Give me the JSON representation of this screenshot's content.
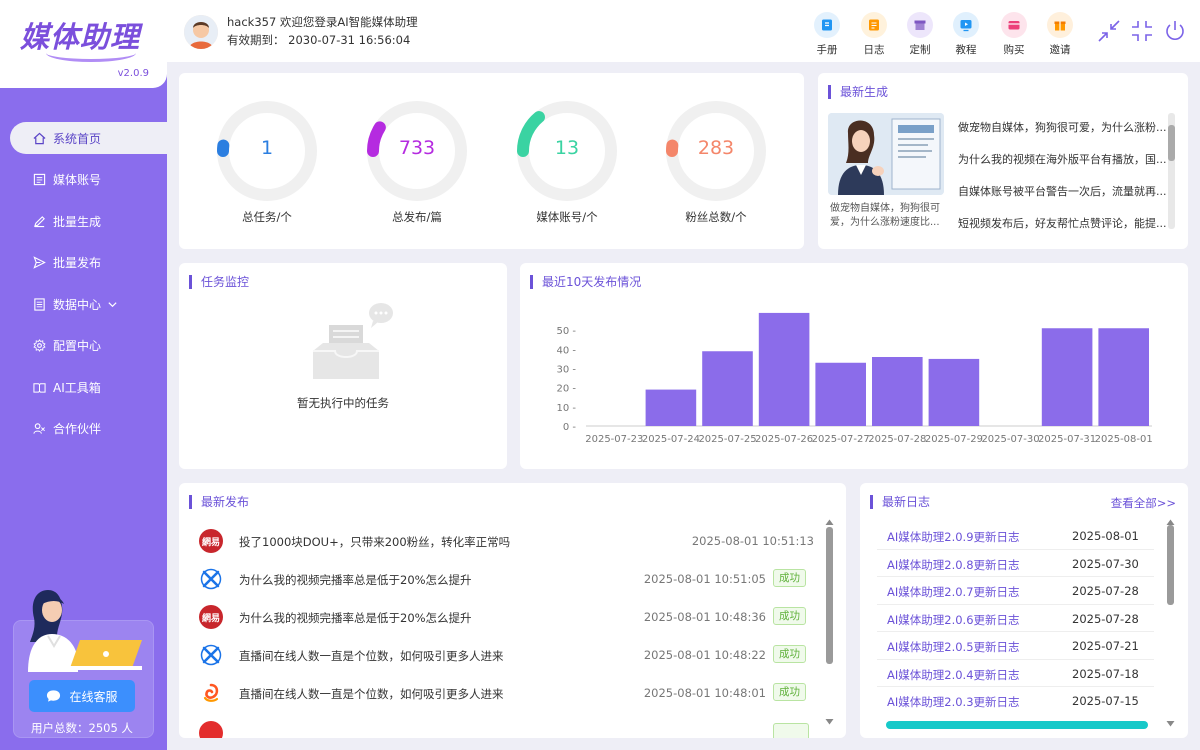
{
  "sidebar": {
    "logo": "媒体助理",
    "version": "v2.0.9",
    "items": [
      {
        "label": "系统首页",
        "icon": "home-icon",
        "active": true
      },
      {
        "label": "媒体账号",
        "icon": "account-card-icon"
      },
      {
        "label": "批量生成",
        "icon": "pencil-icon"
      },
      {
        "label": "批量发布",
        "icon": "send-icon"
      },
      {
        "label": "数据中心",
        "icon": "document-icon",
        "expandable": true
      },
      {
        "label": "配置中心",
        "icon": "gear-icon"
      },
      {
        "label": "AI工具箱",
        "icon": "toolbox-icon"
      },
      {
        "label": "合作伙伴",
        "icon": "partner-icon"
      }
    ],
    "support_label": "在线客服",
    "user_total": "用户总数：2505 人"
  },
  "header": {
    "welcome": "hack357 欢迎您登录AI智能媒体助理",
    "expire": "有效期到： 2030-07-31 16:56:04",
    "tools": [
      {
        "label": "手册",
        "icon": "manual-icon",
        "color": "#2196f3"
      },
      {
        "label": "日志",
        "icon": "log-icon",
        "color": "#ff9800"
      },
      {
        "label": "定制",
        "icon": "custom-icon",
        "color": "#7e57c2"
      },
      {
        "label": "教程",
        "icon": "tutorial-icon",
        "color": "#2196f3"
      },
      {
        "label": "购买",
        "icon": "purchase-icon",
        "color": "#ec407a"
      },
      {
        "label": "邀请",
        "icon": "invite-icon",
        "color": "#ff9800"
      }
    ]
  },
  "stats": [
    {
      "value": "1",
      "label": "总任务/个",
      "color": "#2b7ee0",
      "fraction": 0.02
    },
    {
      "value": "733",
      "label": "总发布/篇",
      "color": "#b52be0",
      "fraction": 0.09
    },
    {
      "value": "13",
      "label": "媒体账号/个",
      "color": "#3ad3a2",
      "fraction": 0.14
    },
    {
      "value": "283",
      "label": "粉丝总数/个",
      "color": "#f4866a",
      "fraction": 0.02
    }
  ],
  "latest": {
    "title": "最新生成",
    "caption": "做宠物自媒体，狗狗很可爱，为什么涨粉速度比...",
    "items": [
      "做宠物自媒体，狗狗很可爱，为什么涨粉...",
      "为什么我的视频在海外版平台有播放，国...",
      "自媒体账号被平台警告一次后，流量就再...",
      "短视频发布后，好友帮忙点赞评论，能提..."
    ]
  },
  "monitor": {
    "title": "任务监控",
    "empty": "暂无执行中的任务"
  },
  "chart_panel": {
    "title": "最近10天发布情况"
  },
  "chart_data": {
    "type": "bar",
    "categories": [
      "2025-07-23",
      "2025-07-24",
      "2025-07-25",
      "2025-07-26",
      "2025-07-27",
      "2025-07-28",
      "2025-07-29",
      "2025-07-30",
      "2025-07-31",
      "2025-08-01"
    ],
    "values": [
      0,
      19,
      39,
      59,
      33,
      36,
      35,
      0,
      51,
      51
    ],
    "yticks": [
      0,
      10,
      20,
      30,
      40,
      50
    ],
    "ylim": [
      0,
      60
    ],
    "color": "#8b6cea",
    "title": "",
    "xlabel": "",
    "ylabel": ""
  },
  "publish": {
    "title": "最新发布",
    "rows": [
      {
        "title": "投了1000块DOU+，只带来200粉丝，转化率正常吗",
        "time": "2025-08-01 10:51:13",
        "status": "",
        "platform": "netease-icon"
      },
      {
        "title": "为什么我的视频完播率总是低于20%怎么提升",
        "time": "2025-08-01 10:51:05",
        "status": "成功",
        "platform": "twist-logo-icon"
      },
      {
        "title": "为什么我的视频完播率总是低于20%怎么提升",
        "time": "2025-08-01 10:48:36",
        "status": "成功",
        "platform": "netease-icon"
      },
      {
        "title": "直播间在线人数一直是个位数，如何吸引更多人进来",
        "time": "2025-08-01 10:48:22",
        "status": "成功",
        "platform": "twist-logo-icon"
      },
      {
        "title": "直播间在线人数一直是个位数，如何吸引更多人进来",
        "time": "2025-08-01 10:48:01",
        "status": "成功",
        "platform": "swirl-logo-icon"
      }
    ]
  },
  "logs": {
    "title": "最新日志",
    "view_all": "查看全部>>",
    "rows": [
      {
        "name": "AI媒体助理2.0.9更新日志",
        "date": "2025-08-01"
      },
      {
        "name": "AI媒体助理2.0.8更新日志",
        "date": "2025-07-30"
      },
      {
        "name": "AI媒体助理2.0.7更新日志",
        "date": "2025-07-28"
      },
      {
        "name": "AI媒体助理2.0.6更新日志",
        "date": "2025-07-28"
      },
      {
        "name": "AI媒体助理2.0.5更新日志",
        "date": "2025-07-21"
      },
      {
        "name": "AI媒体助理2.0.4更新日志",
        "date": "2025-07-18"
      },
      {
        "name": "AI媒体助理2.0.3更新日志",
        "date": "2025-07-15"
      }
    ]
  }
}
